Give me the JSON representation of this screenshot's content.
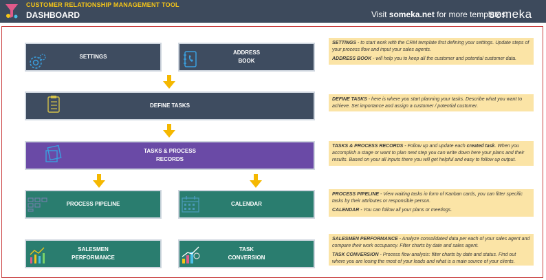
{
  "header": {
    "app_title": "CUSTOMER RELATIONSHIP MANAGEMENT TOOL",
    "page_title": "DASHBOARD",
    "visit_prefix": "Visit",
    "visit_link": "someka.net",
    "visit_suffix": "for more templates",
    "brand": "someka"
  },
  "cards": {
    "settings": "SETTINGS",
    "address_book": "ADDRESS\nBOOK",
    "define_tasks": "DEFINE TASKS",
    "tasks_records": "TASKS & PROCESS\nRECORDS",
    "process_pipeline": "PROCESS PIPELINE",
    "calendar": "CALENDAR",
    "salesmen_performance": "SALESMEN\nPERFORMANCE",
    "task_conversion": "TASK\nCONVERSION"
  },
  "notes": {
    "n1": [
      {
        "bold": "SETTINGS",
        "text": " - to start work with the CRM template first defining your settings. Update steps of your process flow and input your sales agents."
      },
      {
        "bold": "ADDRESS BOOK",
        "text": " - will help you to keep all the customer and potential customer data."
      }
    ],
    "n2": [
      {
        "bold": "DEFINE TASKS",
        "text": " - here is where you start planning your tasks. Describe what you want to achieve. Set importance and assign a customer / potential customer."
      }
    ],
    "n3": [
      {
        "bold": "TASKS & PROCESS RECORDS",
        "text": " - Follow up and update each ",
        "bold2": "created task",
        "text2": ". When you accomplish a stage or want to plan next step you can write down here your plans and their results. Based on your all inputs there you will get helpful and easy to follow up output."
      }
    ],
    "n4": [
      {
        "bold": "PROCESS PIPELINE",
        "text": " - View waiting tasks in form of Kanban cards, you can fitter specific tasks by their attributes or responsible person."
      },
      {
        "bold": "CALENDAR",
        "text": " -  You can follow all your plans or meetings."
      }
    ],
    "n5": [
      {
        "bold": "SALESMEN PERFORMANCE",
        "text": " - Analyze consolidated data per each of your sales agent and compare their work occupancy. Filter charts by date and sales agent."
      },
      {
        "bold": "TASK CONVERSION",
        "text": " - Process flow analysis: filter charts by date and status. Find out where you are losing the most of your leads and what is a main source of your clients."
      }
    ]
  },
  "colors": {
    "header_bg": "#3d4a5c",
    "accent_yellow": "#f5c518",
    "card_slate": "#3e4c60",
    "card_purple": "#6a4aa6",
    "card_teal": "#2a7d6f",
    "note_bg": "#fbe4a6",
    "arrow": "#f5b800",
    "icon_blue": "#3aa0e0"
  }
}
